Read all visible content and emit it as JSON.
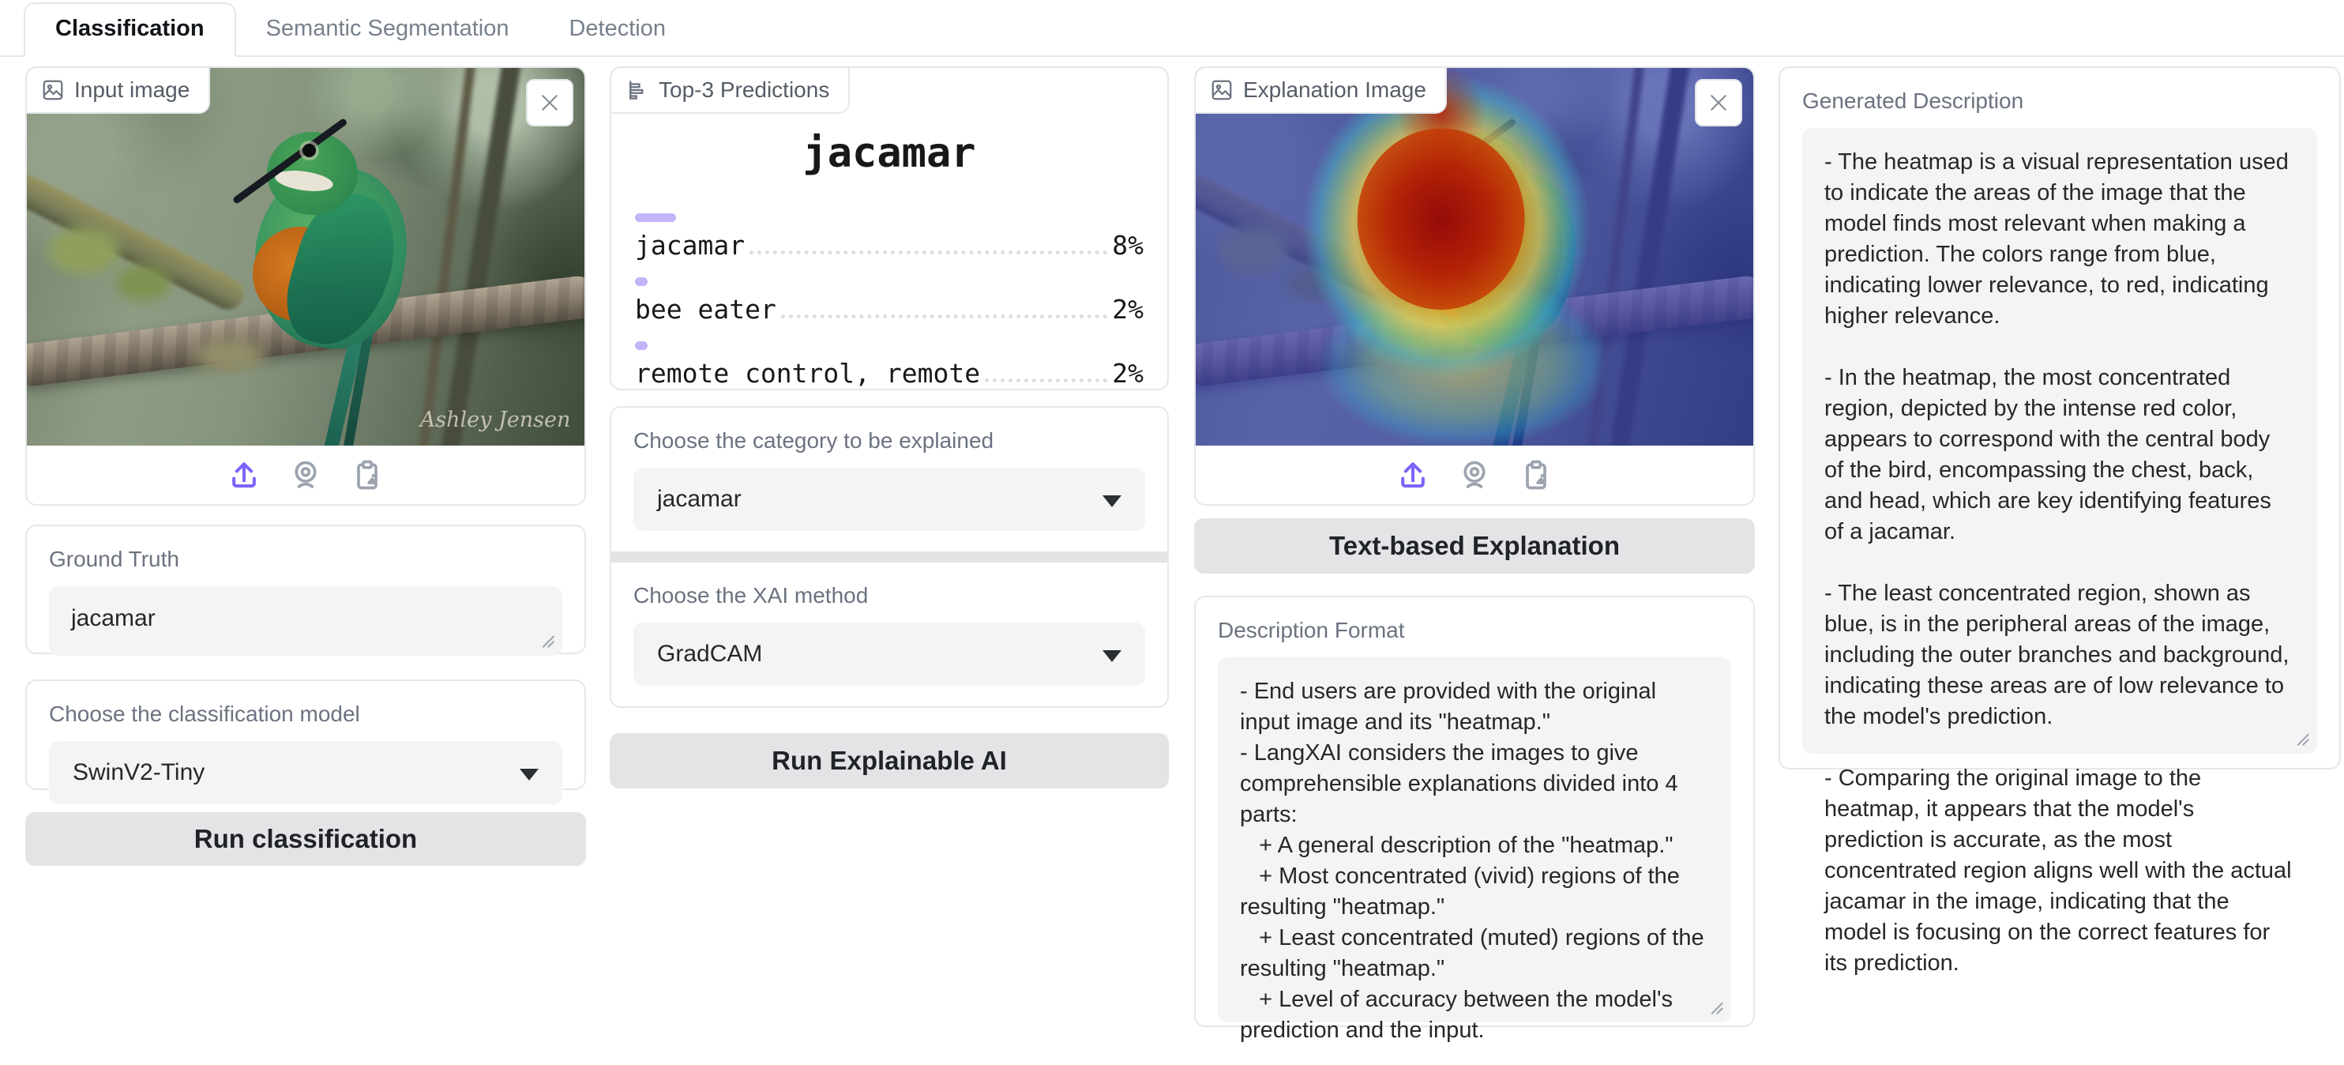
{
  "tabs": [
    {
      "label": "Classification",
      "active": true
    },
    {
      "label": "Semantic Segmentation",
      "active": false
    },
    {
      "label": "Detection",
      "active": false
    }
  ],
  "input_panel": {
    "image_label": "Input image",
    "watermark": "Ashley Jensen",
    "ground_truth": {
      "label": "Ground Truth",
      "value": "jacamar"
    },
    "model_select": {
      "label": "Choose the classification model",
      "value": "SwinV2-Tiny"
    },
    "run_button": "Run classification"
  },
  "predictions_panel": {
    "label": "Top-3 Predictions",
    "top_class": "jacamar",
    "items": [
      {
        "label": "jacamar",
        "confidence": "8%",
        "bar_pct": 8
      },
      {
        "label": "bee eater",
        "confidence": "2%",
        "bar_pct": 2
      },
      {
        "label": "remote control, remote",
        "confidence": "2%",
        "bar_pct": 2
      }
    ],
    "category_select": {
      "label": "Choose the category to be explained",
      "value": "jacamar"
    },
    "xai_select": {
      "label": "Choose the XAI method",
      "value": "GradCAM"
    },
    "run_button": "Run Explainable AI"
  },
  "explanation_panel": {
    "image_label": "Explanation Image",
    "text_button": "Text-based Explanation",
    "description_format": {
      "label": "Description Format",
      "value": "- End users are provided with the original input image and its \"heatmap.\"\n- LangXAI considers the images to give comprehensible explanations divided into 4 parts:\n   + A general description of the \"heatmap.\"\n   + Most concentrated (vivid) regions of the resulting \"heatmap.\"\n   + Least concentrated (muted) regions of the resulting \"heatmap.\"\n   + Level of accuracy between the model's prediction and the input."
    }
  },
  "generated_panel": {
    "label": "Generated Description",
    "value": "- The heatmap is a visual representation used to indicate the areas of the image that the model finds most relevant when making a prediction. The colors range from blue, indicating lower relevance, to red, indicating higher relevance.\n\n- In the heatmap, the most concentrated region, depicted by the intense red color, appears to correspond with the central body of the bird, encompassing the chest, back, and head, which are key identifying features of a jacamar.\n\n- The least concentrated region, shown as blue, is in the peripheral areas of the image, including the outer branches and background, indicating these areas are of low relevance to the model's prediction.\n\n- Comparing the original image to the heatmap, it appears that the model's prediction is accurate, as the most concentrated region aligns well with the actual jacamar in the image, indicating that the model is focusing on the correct features for its prediction."
  },
  "colors": {
    "accent": "#7c63fa",
    "confidence_bar": "#c3b4f8",
    "card_border": "#e5e7eb"
  }
}
